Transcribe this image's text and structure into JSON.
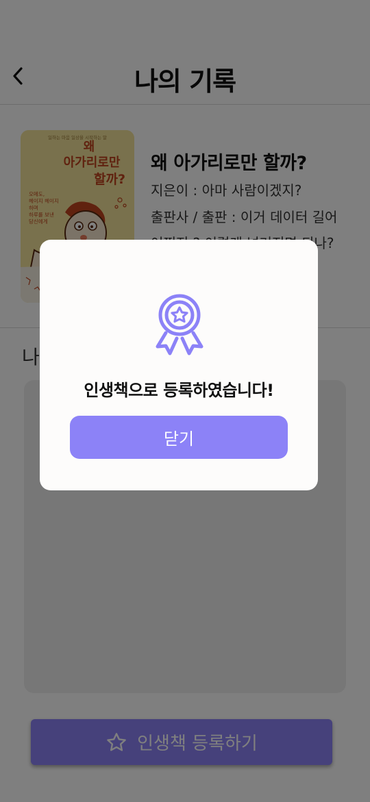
{
  "header": {
    "title": "나의 기록"
  },
  "book": {
    "title": "왜 아가리로만 할까?",
    "author": "지은이 :  아마 사람이겠지?",
    "publisher": "출판사 / 출판 :  이거 데이터 길어",
    "publisher_cont": "어쩌지 ? 이렇게 넘겨지면 되나?",
    "cover": {
      "top_text": "일하는 마음 일상을 시작하는 말",
      "title_line1": "왜",
      "title_line2": "아가리로만",
      "title_line3": "할까?",
      "side_lines": [
        "오메도,",
        "헤이지 헤이지",
        "하며",
        "하루를 보낸",
        "당신에게"
      ]
    }
  },
  "memo": {
    "label": "나"
  },
  "register_button": {
    "label": "인생책 등록하기",
    "icon": "star-outline-icon"
  },
  "modal": {
    "icon": "award-badge-icon",
    "message": "인생책으로 등록하였습니다!",
    "close_label": "닫기"
  },
  "colors": {
    "accent": "#8c82f7",
    "overlay": "rgba(0,0,0,0.5)",
    "modal_bg": "#fdfcfb",
    "cover_bg": "#f3e39a",
    "cover_text": "#c0441e"
  }
}
